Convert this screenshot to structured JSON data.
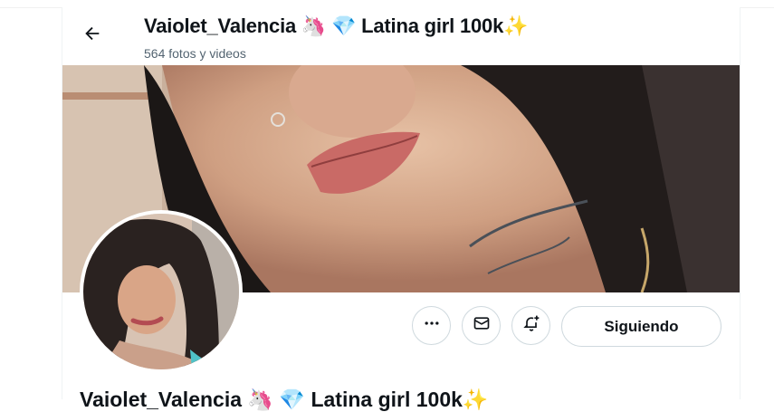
{
  "header": {
    "title": "Vaiolet_Valencia 🦄 💎 Latina girl 100k✨",
    "subtitle": "564 fotos y videos"
  },
  "profile": {
    "display_name": "Vaiolet_Valencia 🦄 💎 Latina girl 100k✨"
  },
  "actions": {
    "follow_label": "Siguiendo"
  },
  "icons": {
    "back": "arrow-left-icon",
    "more": "more-dots-icon",
    "message": "envelope-icon",
    "notify": "bell-plus-icon"
  },
  "colors": {
    "text": "#0f1419",
    "muted": "#536471",
    "border": "#cfd9de"
  }
}
